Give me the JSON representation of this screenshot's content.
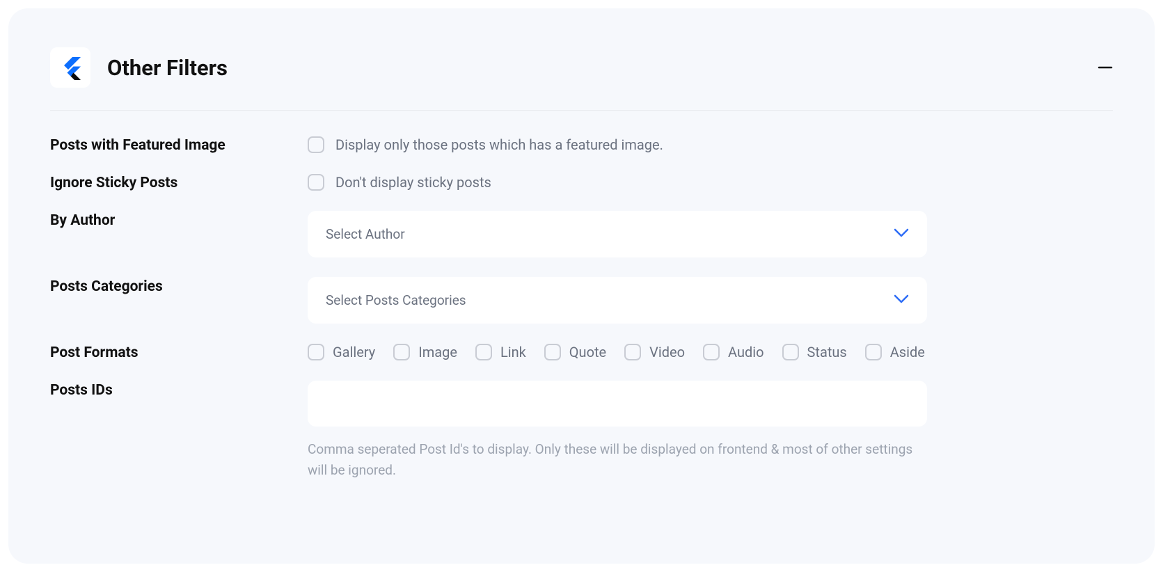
{
  "panel": {
    "title": "Other Filters"
  },
  "rows": {
    "featured": {
      "label": "Posts with Featured Image",
      "checkbox_label": "Display only those posts which has a featured image."
    },
    "sticky": {
      "label": "Ignore Sticky Posts",
      "checkbox_label": "Don't display sticky posts"
    },
    "author": {
      "label": "By Author",
      "placeholder": "Select Author"
    },
    "categories": {
      "label": "Posts Categories",
      "placeholder": "Select Posts Categories"
    },
    "formats": {
      "label": "Post Formats",
      "options": {
        "gallery": "Gallery",
        "image": "Image",
        "link": "Link",
        "quote": "Quote",
        "video": "Video",
        "audio": "Audio",
        "status": "Status",
        "aside": "Aside"
      }
    },
    "ids": {
      "label": "Posts IDs",
      "helper": "Comma seperated Post Id's to display. Only these will be displayed on frontend & most of other settings will be ignored."
    }
  }
}
